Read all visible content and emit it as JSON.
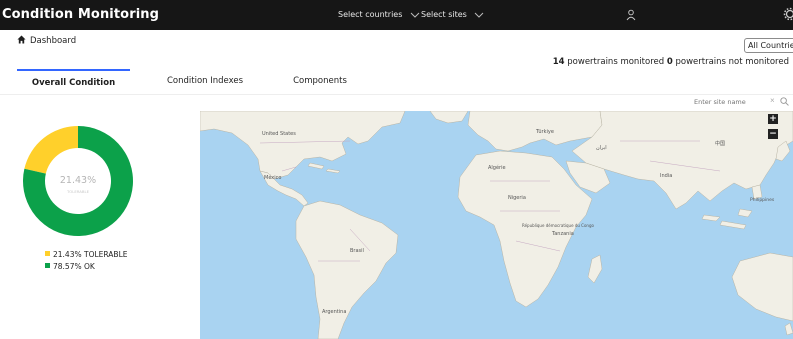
{
  "app": {
    "title": "Condition Monitoring"
  },
  "header": {
    "countries_label": "Select countries",
    "sites_label": "Select sites"
  },
  "breadcrumb": {
    "label": "Dashboard"
  },
  "filter": {
    "all_countries_label": "All Countries"
  },
  "monitoring": {
    "monitored_count": "14",
    "monitored_label": "powertrains monitored",
    "not_monitored_count": "0",
    "not_monitored_label": "powertrains not monitored"
  },
  "tabs": [
    {
      "label": "Overall Condition",
      "active": true
    },
    {
      "label": "Condition Indexes",
      "active": false
    },
    {
      "label": "Components",
      "active": false
    }
  ],
  "search": {
    "placeholder": "Enter site name",
    "clear": "×"
  },
  "chart_data": {
    "type": "pie",
    "center_value": "21.43%",
    "center_label": "TOLERABLE",
    "slices": [
      {
        "label": "TOLERABLE",
        "value": 21.43,
        "legend": "21.43% TOLERABLE",
        "color": "#ffd02b"
      },
      {
        "label": "OK",
        "value": 78.57,
        "legend": "78.57% OK",
        "color": "#0ca14a"
      }
    ]
  },
  "map": {
    "zoom_in": "+",
    "zoom_out": "−",
    "labels": {
      "united_states": "United States",
      "mexico": "México",
      "brasil": "Brasil",
      "argentina": "Argentina",
      "algerie": "Algérie",
      "nigeria": "Nigeria",
      "rdc": "République démocratique du Congo",
      "tanzania": "Tanzania",
      "india": "India",
      "china": "中国",
      "philippines": "Philippines",
      "turkey": "Türkiye",
      "iran": "ایران"
    }
  },
  "colors": {
    "accent": "#3366ff",
    "topbar": "#161616",
    "ocean": "#a9d3f1",
    "land": "#f1efe6"
  }
}
